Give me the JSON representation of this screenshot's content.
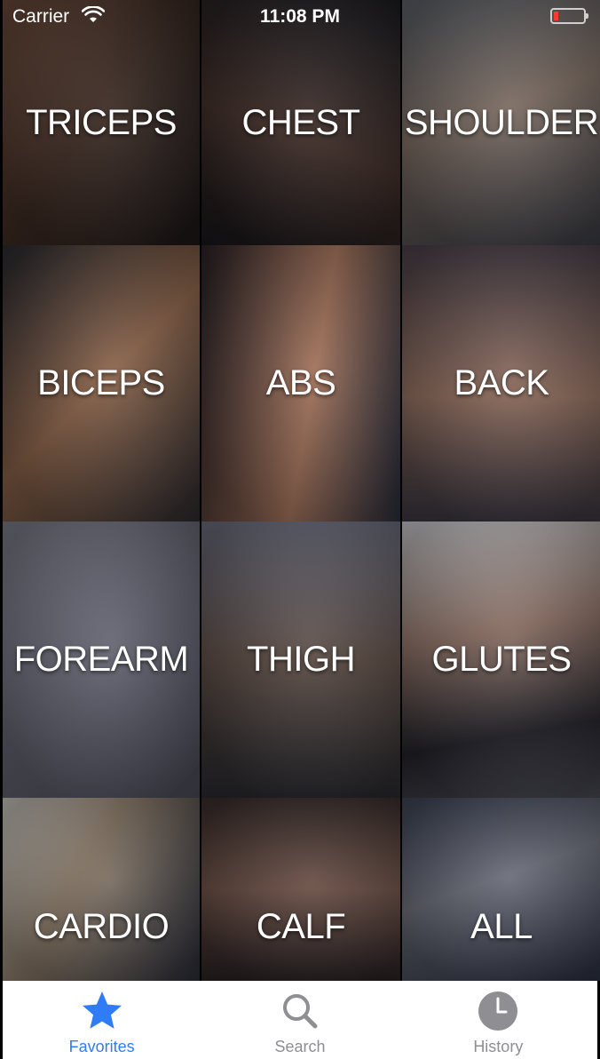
{
  "status_bar": {
    "carrier": "Carrier",
    "time": "11:08 PM"
  },
  "categories": [
    {
      "label": "TRICEPS"
    },
    {
      "label": "CHEST"
    },
    {
      "label": "SHOULDER"
    },
    {
      "label": "BICEPS"
    },
    {
      "label": "ABS"
    },
    {
      "label": "BACK"
    },
    {
      "label": "FOREARM"
    },
    {
      "label": "THIGH"
    },
    {
      "label": "GLUTES"
    },
    {
      "label": "CARDIO"
    },
    {
      "label": "CALF"
    },
    {
      "label": "ALL"
    }
  ],
  "tab_bar": {
    "tabs": [
      {
        "label": "Favorites",
        "icon": "star-icon",
        "active": true
      },
      {
        "label": "Search",
        "icon": "search-icon",
        "active": false
      },
      {
        "label": "History",
        "icon": "clock-icon",
        "active": false
      }
    ]
  },
  "colors": {
    "active_tab": "#2f7cf6",
    "inactive_tab": "#8e8e93",
    "battery_low": "#ff3b30"
  }
}
